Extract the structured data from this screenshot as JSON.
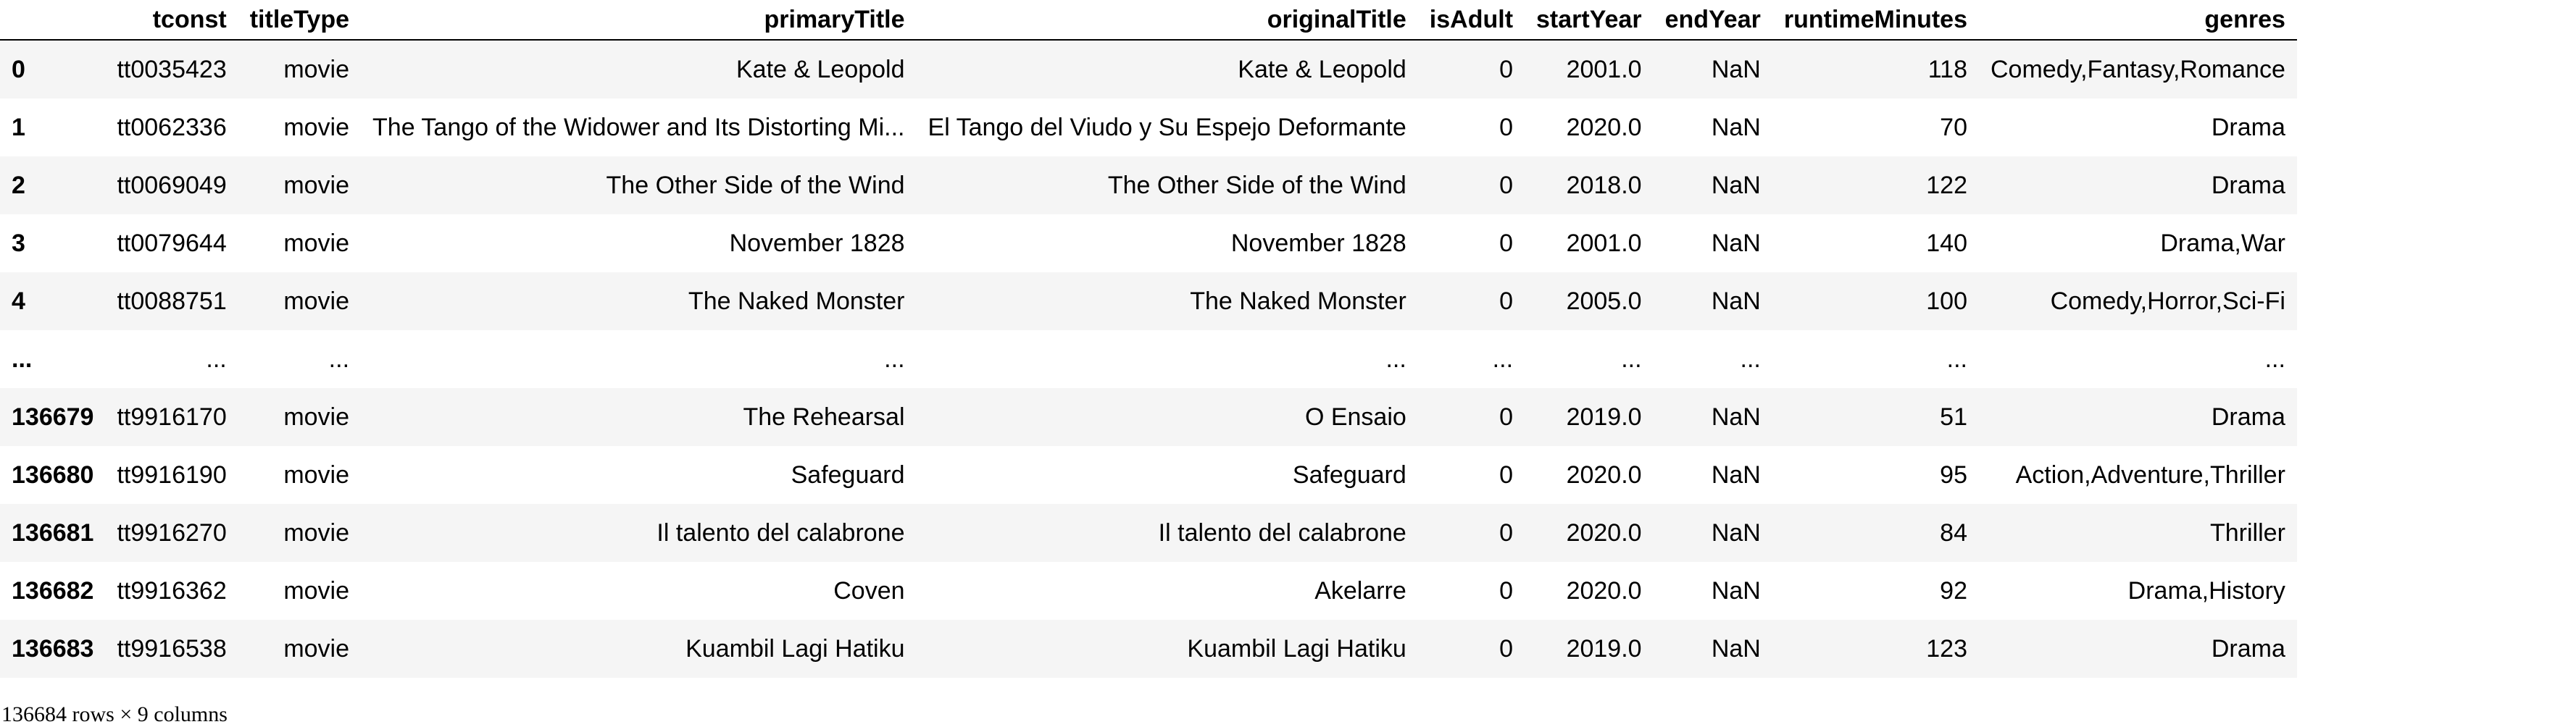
{
  "dataframe": {
    "index_header": "",
    "columns": [
      "tconst",
      "titleType",
      "primaryTitle",
      "originalTitle",
      "isAdult",
      "startYear",
      "endYear",
      "runtimeMinutes",
      "genres"
    ],
    "rows": [
      {
        "index": "0",
        "cells": [
          "tt0035423",
          "movie",
          "Kate & Leopold",
          "Kate & Leopold",
          "0",
          "2001.0",
          "NaN",
          "118",
          "Comedy,Fantasy,Romance"
        ]
      },
      {
        "index": "1",
        "cells": [
          "tt0062336",
          "movie",
          "The Tango of the Widower and Its Distorting Mi...",
          "El Tango del Viudo y Su Espejo Deformante",
          "0",
          "2020.0",
          "NaN",
          "70",
          "Drama"
        ]
      },
      {
        "index": "2",
        "cells": [
          "tt0069049",
          "movie",
          "The Other Side of the Wind",
          "The Other Side of the Wind",
          "0",
          "2018.0",
          "NaN",
          "122",
          "Drama"
        ]
      },
      {
        "index": "3",
        "cells": [
          "tt0079644",
          "movie",
          "November 1828",
          "November 1828",
          "0",
          "2001.0",
          "NaN",
          "140",
          "Drama,War"
        ]
      },
      {
        "index": "4",
        "cells": [
          "tt0088751",
          "movie",
          "The Naked Monster",
          "The Naked Monster",
          "0",
          "2005.0",
          "NaN",
          "100",
          "Comedy,Horror,Sci-Fi"
        ]
      },
      {
        "index": "...",
        "cells": [
          "...",
          "...",
          "...",
          "...",
          "...",
          "...",
          "...",
          "...",
          "..."
        ],
        "ellipsis": true
      },
      {
        "index": "136679",
        "cells": [
          "tt9916170",
          "movie",
          "The Rehearsal",
          "O Ensaio",
          "0",
          "2019.0",
          "NaN",
          "51",
          "Drama"
        ]
      },
      {
        "index": "136680",
        "cells": [
          "tt9916190",
          "movie",
          "Safeguard",
          "Safeguard",
          "0",
          "2020.0",
          "NaN",
          "95",
          "Action,Adventure,Thriller"
        ]
      },
      {
        "index": "136681",
        "cells": [
          "tt9916270",
          "movie",
          "Il talento del calabrone",
          "Il talento del calabrone",
          "0",
          "2020.0",
          "NaN",
          "84",
          "Thriller"
        ]
      },
      {
        "index": "136682",
        "cells": [
          "tt9916362",
          "movie",
          "Coven",
          "Akelarre",
          "0",
          "2020.0",
          "NaN",
          "92",
          "Drama,History"
        ]
      },
      {
        "index": "136683",
        "cells": [
          "tt9916538",
          "movie",
          "Kuambil Lagi Hatiku",
          "Kuambil Lagi Hatiku",
          "0",
          "2019.0",
          "NaN",
          "123",
          "Drama"
        ]
      }
    ],
    "shape_text": "136684 rows × 9 columns"
  }
}
